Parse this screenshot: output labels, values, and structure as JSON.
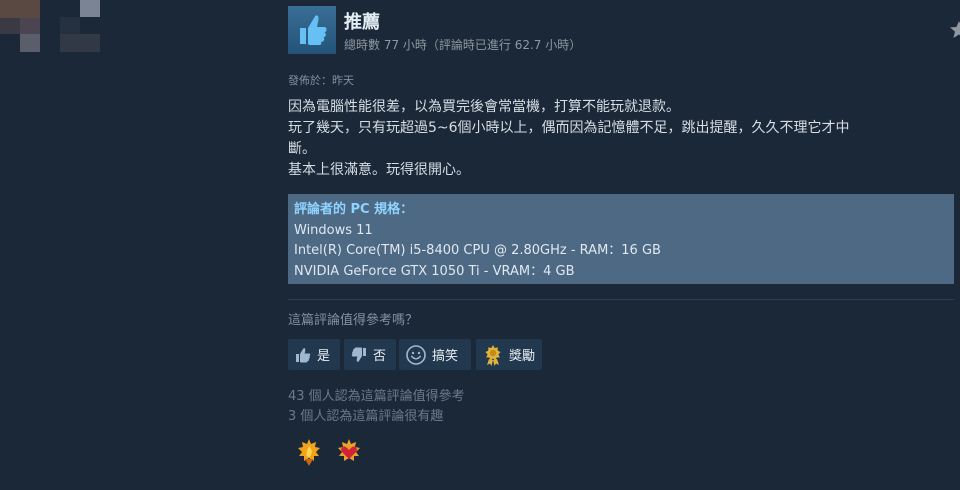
{
  "review": {
    "recommendation": "推薦",
    "hours_total_label": "總時數 77 小時",
    "hours_at_review": "（評論時已進行 62.7 小時）",
    "posted_label": "發佈於：",
    "posted_value": "昨天",
    "body_lines": [
      "因為電腦性能很差，以為買完後會常當機，打算不能玩就退款。",
      "玩了幾天，只有玩超過5~6個小時以上，偶而因為記憶體不足，跳出提醒，久久不理它才中",
      "斷。",
      "基本上很滿意。玩得很開心。"
    ],
    "specs": {
      "title": "評論者的 PC 規格：",
      "lines": [
        "Windows 11",
        "Intel(R) Core(TM) i5-8400 CPU @ 2.80GHz - RAM：16 GB",
        "NVIDIA GeForce GTX 1050 Ti - VRAM：4 GB"
      ]
    }
  },
  "voting": {
    "question": "這篇評論值得參考嗎？",
    "yes_label": "是",
    "no_label": "否",
    "funny_label": "搞笑",
    "award_label": "獎勵"
  },
  "stats": {
    "helpful": "43 個人認為這篇評論值得參考",
    "funny": "3 個人認為這篇評論很有趣"
  },
  "icons": {
    "header": "thumbs-up-icon",
    "corner": "star-icon",
    "yes": "thumbs-up-icon",
    "no": "thumbs-down-icon",
    "funny": "smiley-icon",
    "award": "award-medal-icon",
    "award_badges": [
      "flame-award-icon",
      "heart-award-icon"
    ]
  },
  "colors": {
    "background": "#1b2838",
    "thumb_box": "#2f6490",
    "specs_bg": "#4e6984",
    "specs_title": "#8fd4ff",
    "button_bg": "#22384f"
  }
}
